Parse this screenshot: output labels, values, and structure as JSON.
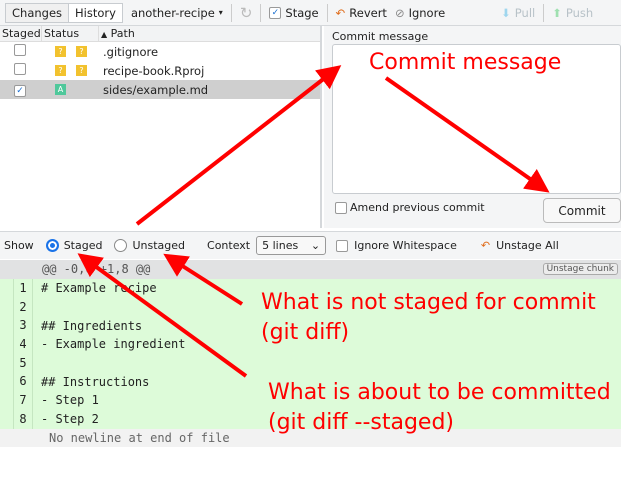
{
  "toolbar": {
    "tabs": [
      "Changes",
      "History"
    ],
    "branch": "another-recipe",
    "stage": "Stage",
    "revert": "Revert",
    "ignore": "Ignore",
    "pull": "Pull",
    "push": "Push"
  },
  "files": {
    "headers": [
      "Staged",
      "Status",
      "Path"
    ],
    "rows": [
      {
        "staged": false,
        "status": [
          "?",
          "?"
        ],
        "path": ".gitignore"
      },
      {
        "staged": false,
        "status": [
          "?",
          "?"
        ],
        "path": "recipe-book.Rproj"
      },
      {
        "staged": true,
        "status": [
          "A"
        ],
        "path": "sides/example.md"
      }
    ]
  },
  "commit": {
    "label": "Commit message",
    "amend": "Amend previous commit",
    "button": "Commit"
  },
  "show": {
    "label": "Show",
    "staged": "Staged",
    "unstaged": "Unstaged",
    "context_label": "Context",
    "context_value": "5 lines",
    "ignore_ws": "Ignore Whitespace",
    "unstage_all": "Unstage All"
  },
  "diff": {
    "hunk": "@@ -0,0 +1,8 @@",
    "unstage_chunk": "Unstage chunk",
    "lines": [
      "# Example recipe",
      "",
      "## Ingredients",
      "- Example ingredient",
      "",
      "## Instructions",
      "- Step 1",
      "- Step 2"
    ],
    "nonewline": "No newline at end of file"
  },
  "annotations": {
    "commit_message": "Commit message",
    "unstaged_1": "What is not staged for  commit",
    "unstaged_2": "(git diff)",
    "staged_1": "What is about to be committed",
    "staged_2": "(git diff --staged)"
  },
  "colors": {
    "annotation": "#ff0000",
    "added_bg": "#ddfbd9"
  }
}
